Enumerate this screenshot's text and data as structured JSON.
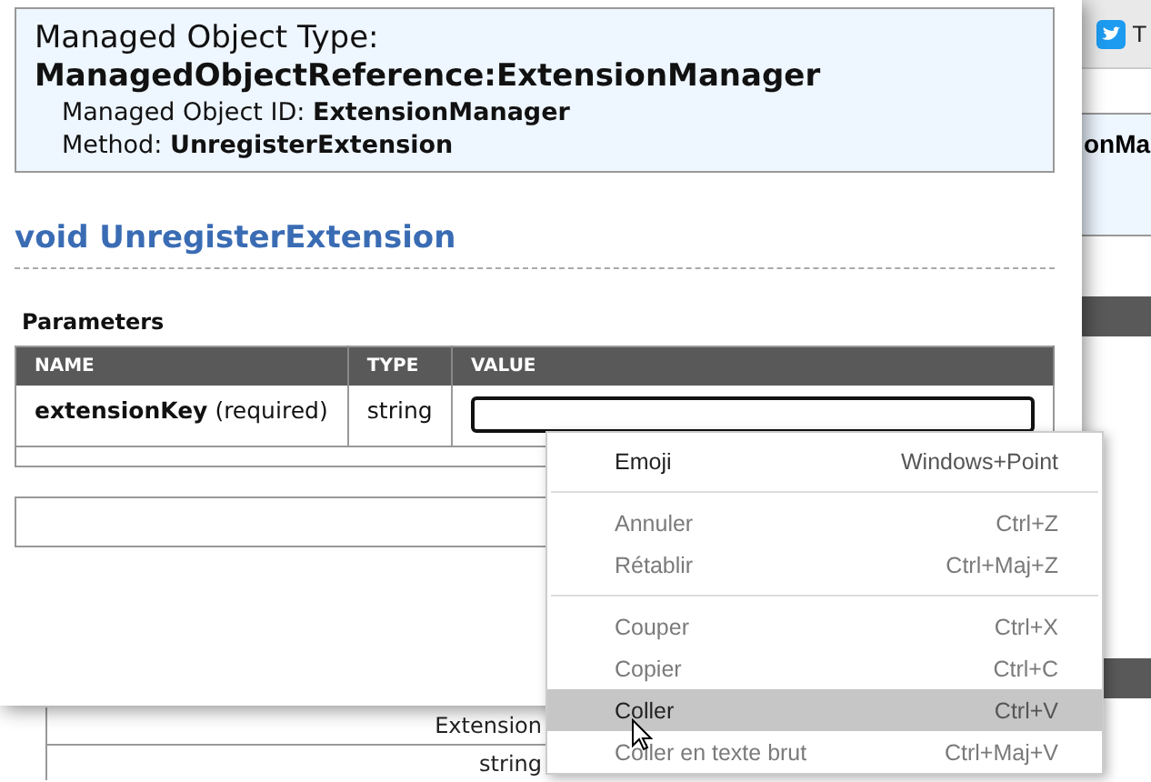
{
  "background_page": {
    "tab_label": "T",
    "heading_fragment": "onMa",
    "table_cells": [
      "Extension",
      "string"
    ]
  },
  "dialog": {
    "header": {
      "type_label": "Managed Object Type:",
      "type_value": "ManagedObjectReference:ExtensionManager",
      "id_label": "Managed Object ID:",
      "id_value": "ExtensionManager",
      "method_label": "Method:",
      "method_value": "UnregisterExtension"
    },
    "method_title": "void UnregisterExtension",
    "parameters": {
      "title": "Parameters",
      "columns": [
        "NAME",
        "TYPE",
        "VALUE"
      ],
      "rows": [
        {
          "name": "extensionKey",
          "note": "(required)",
          "type": "string"
        }
      ]
    }
  },
  "context_menu": {
    "groups": [
      [
        {
          "label": "Emoji",
          "shortcut": "Windows+Point",
          "disabled": false,
          "selected": false
        }
      ],
      [
        {
          "label": "Annuler",
          "shortcut": "Ctrl+Z",
          "disabled": true,
          "selected": false
        },
        {
          "label": "Rétablir",
          "shortcut": "Ctrl+Maj+Z",
          "disabled": true,
          "selected": false
        }
      ],
      [
        {
          "label": "Couper",
          "shortcut": "Ctrl+X",
          "disabled": true,
          "selected": false
        },
        {
          "label": "Copier",
          "shortcut": "Ctrl+C",
          "disabled": true,
          "selected": false
        },
        {
          "label": "Coller",
          "shortcut": "Ctrl+V",
          "disabled": false,
          "selected": true
        },
        {
          "label": "Coller en texte brut",
          "shortcut": "Ctrl+Maj+V",
          "disabled": true,
          "selected": false
        }
      ]
    ]
  }
}
